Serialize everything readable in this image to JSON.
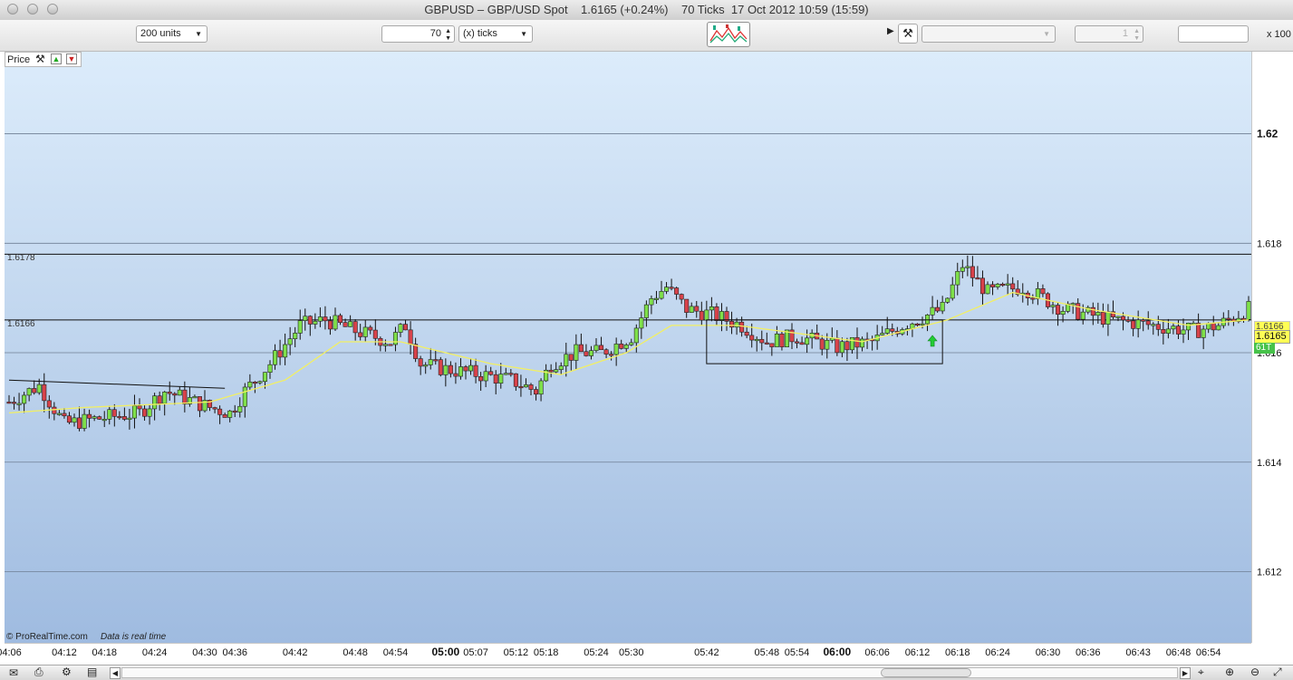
{
  "window": {
    "title": "GBPUSD – GBP/USD Spot    1.6165 (+0.24%)    70 Ticks  17 Oct 2012 10:59 (15:59)"
  },
  "toolbar": {
    "units_select": "200 units",
    "ticks_value": "70",
    "ticks_unit_select": "(x) ticks",
    "scale_label": "x 100",
    "spin_value": "1"
  },
  "chart": {
    "price_tab_label": "Price",
    "copyright": "© ProRealTime.com",
    "realtime_note": "Data is real time",
    "level_labels": [
      "1.6178",
      "1.6166"
    ],
    "current_price": "1.6165",
    "price_tag_2": "1.6166",
    "tick_badge": "61T"
  },
  "colors": {
    "up": "#7fe04a",
    "down": "#d8424a",
    "moving_average": "#f2ef63",
    "badge_bg": "#ffff55",
    "tick_badge_bg": "#46c24a"
  },
  "icons": {
    "toolbar_chart_style": "chart-style-icon",
    "toolbar_wrench": "wrench-icon",
    "price_tab_wrench": "wrench-icon",
    "price_tab_up": "arrow-up-icon",
    "price_tab_down": "arrow-down-icon",
    "signal_arrow": "green-up-arrow-icon"
  },
  "chart_data": {
    "type": "candlestick",
    "symbol": "GBPUSD",
    "y_ticks": [
      {
        "value": 1.62,
        "label": "1.62",
        "bold": true
      },
      {
        "value": 1.618,
        "label": "1.618",
        "bold": false
      },
      {
        "value": 1.616,
        "label": "1.616",
        "bold": false
      },
      {
        "value": 1.614,
        "label": "1.614",
        "bold": false
      },
      {
        "value": 1.612,
        "label": "1.612",
        "bold": false
      }
    ],
    "ylim": [
      1.6107,
      1.6215
    ],
    "grid": true,
    "x_labels": [
      {
        "label": "04:06",
        "i": 0,
        "bold": false
      },
      {
        "label": "04:12",
        "i": 11,
        "bold": false
      },
      {
        "label": "04:18",
        "i": 19,
        "bold": false
      },
      {
        "label": "04:24",
        "i": 29,
        "bold": false
      },
      {
        "label": "04:30",
        "i": 39,
        "bold": false
      },
      {
        "label": "04:36",
        "i": 45,
        "bold": false
      },
      {
        "label": "04:42",
        "i": 57,
        "bold": false
      },
      {
        "label": "04:48",
        "i": 69,
        "bold": false
      },
      {
        "label": "04:54",
        "i": 77,
        "bold": false
      },
      {
        "label": "05:00",
        "i": 87,
        "bold": true
      },
      {
        "label": "05:07",
        "i": 93,
        "bold": false
      },
      {
        "label": "05:12",
        "i": 101,
        "bold": false
      },
      {
        "label": "05:18",
        "i": 107,
        "bold": false
      },
      {
        "label": "05:24",
        "i": 117,
        "bold": false
      },
      {
        "label": "05:30",
        "i": 124,
        "bold": false
      },
      {
        "label": "05:42",
        "i": 139,
        "bold": false
      },
      {
        "label": "05:48",
        "i": 151,
        "bold": false
      },
      {
        "label": "05:54",
        "i": 157,
        "bold": false
      },
      {
        "label": "06:00",
        "i": 165,
        "bold": true
      },
      {
        "label": "06:06",
        "i": 173,
        "bold": false
      },
      {
        "label": "06:12",
        "i": 181,
        "bold": false
      },
      {
        "label": "06:18",
        "i": 189,
        "bold": false
      },
      {
        "label": "06:24",
        "i": 197,
        "bold": false
      },
      {
        "label": "06:30",
        "i": 207,
        "bold": false
      },
      {
        "label": "06:36",
        "i": 215,
        "bold": false
      },
      {
        "label": "06:43",
        "i": 225,
        "bold": false
      },
      {
        "label": "06:48",
        "i": 233,
        "bold": false
      },
      {
        "label": "06:54",
        "i": 239,
        "bold": false
      }
    ],
    "horizontal_levels": [
      1.6178,
      1.6166
    ],
    "trend_line": {
      "from": {
        "i": 0,
        "price": 1.6155
      },
      "to": {
        "i": 43,
        "price": 1.61535
      }
    },
    "range_box": {
      "i_start": 139,
      "i_end": 186,
      "top": 1.6166,
      "bottom": 1.6158
    },
    "signal": {
      "i": 184,
      "price": 1.6162
    },
    "keyframes": [
      [
        0,
        1.6151
      ],
      [
        6,
        1.6154
      ],
      [
        11,
        1.6147
      ],
      [
        18,
        1.6148
      ],
      [
        26,
        1.6149
      ],
      [
        31,
        1.6153
      ],
      [
        40,
        1.615
      ],
      [
        44,
        1.6149
      ],
      [
        47,
        1.6153
      ],
      [
        52,
        1.6158
      ],
      [
        58,
        1.6165
      ],
      [
        63,
        1.6166
      ],
      [
        69,
        1.6164
      ],
      [
        76,
        1.6162
      ],
      [
        79,
        1.6165
      ],
      [
        82,
        1.6158
      ],
      [
        87,
        1.6157
      ],
      [
        94,
        1.6156
      ],
      [
        100,
        1.6155
      ],
      [
        105,
        1.6153
      ],
      [
        108,
        1.6158
      ],
      [
        113,
        1.616
      ],
      [
        118,
        1.616
      ],
      [
        124,
        1.6163
      ],
      [
        128,
        1.617
      ],
      [
        131,
        1.6172
      ],
      [
        135,
        1.6168
      ],
      [
        140,
        1.6167
      ],
      [
        146,
        1.6165
      ],
      [
        151,
        1.6162
      ],
      [
        157,
        1.6163
      ],
      [
        165,
        1.6161
      ],
      [
        172,
        1.6162
      ],
      [
        178,
        1.6165
      ],
      [
        186,
        1.6168
      ],
      [
        190,
        1.6176
      ],
      [
        195,
        1.6171
      ],
      [
        202,
        1.6172
      ],
      [
        210,
        1.6168
      ],
      [
        220,
        1.6166
      ],
      [
        228,
        1.6165
      ],
      [
        236,
        1.6164
      ],
      [
        241,
        1.6165
      ],
      [
        247,
        1.6168
      ]
    ],
    "moving_average_keyframes": [
      [
        0,
        1.6149
      ],
      [
        15,
        1.615
      ],
      [
        40,
        1.6151
      ],
      [
        55,
        1.6155
      ],
      [
        66,
        1.6162
      ],
      [
        78,
        1.6162
      ],
      [
        96,
        1.6158
      ],
      [
        110,
        1.6156
      ],
      [
        123,
        1.616
      ],
      [
        132,
        1.6165
      ],
      [
        145,
        1.6165
      ],
      [
        170,
        1.6162
      ],
      [
        187,
        1.6166
      ],
      [
        200,
        1.6171
      ],
      [
        215,
        1.6168
      ],
      [
        235,
        1.6165
      ],
      [
        247,
        1.6166
      ]
    ],
    "bar_count": 248
  }
}
